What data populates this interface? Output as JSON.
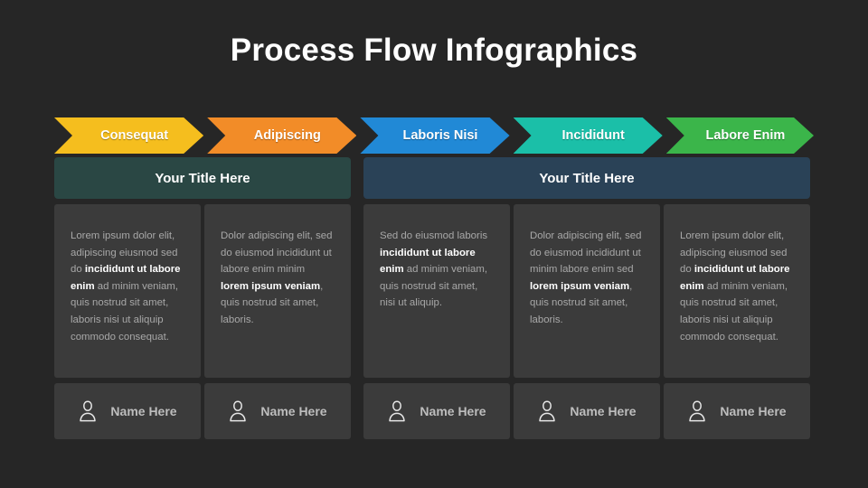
{
  "slide": {
    "title": "Process Flow Infographics",
    "background_color": "#262626",
    "card_color": "#3b3b3b"
  },
  "steps": [
    {
      "label": "Consequat",
      "color": "#F5BE1E"
    },
    {
      "label": "Adipiscing",
      "color": "#F28C28"
    },
    {
      "label": "Laboris Nisi",
      "color": "#2189D6"
    },
    {
      "label": "Incididunt",
      "color": "#1BBFA8"
    },
    {
      "label": "Labore Enim",
      "color": "#3BB council"
    }
  ],
  "headers": [
    {
      "text": "Your Title Here",
      "color": "#2A4744",
      "span": 2
    },
    {
      "text": "Your Title Here",
      "color": "#2A4257",
      "span": 3
    }
  ],
  "columns": [
    {
      "body_parts": [
        {
          "text": "Lorem ipsum dolor elit, adipiscing eiusmod sed do ",
          "bold": false
        },
        {
          "text": "incididunt ut labore enim",
          "bold": true
        },
        {
          "text": " ad minim veniam, quis nostrud sit amet, laboris nisi ut aliquip commodo consequat.",
          "bold": false
        }
      ],
      "name": "Name Here",
      "icon": "person-icon"
    },
    {
      "body_parts": [
        {
          "text": "Dolor adipiscing elit, sed do eiusmod incididunt ut labore enim minim ",
          "bold": false
        },
        {
          "text": "lorem ipsum veniam",
          "bold": true
        },
        {
          "text": ", quis nostrud sit amet, laboris.",
          "bold": false
        }
      ],
      "name": "Name Here",
      "icon": "person-icon"
    },
    {
      "body_parts": [
        {
          "text": "Sed do eiusmod laboris ",
          "bold": false
        },
        {
          "text": "incididunt ut labore enim",
          "bold": true
        },
        {
          "text": " ad minim veniam, quis nostrud sit amet, nisi ut aliquip.",
          "bold": false
        }
      ],
      "name": "Name Here",
      "icon": "person-icon"
    },
    {
      "body_parts": [
        {
          "text": "Dolor adipiscing elit, sed do eiusmod incididunt ut minim labore enim sed ",
          "bold": false
        },
        {
          "text": "lorem ipsum veniam",
          "bold": true
        },
        {
          "text": ", quis nostrud sit amet, laboris.",
          "bold": false
        }
      ],
      "name": "Name Here",
      "icon": "person-icon"
    },
    {
      "body_parts": [
        {
          "text": "Lorem ipsum dolor elit, adipiscing eiusmod sed do ",
          "bold": false
        },
        {
          "text": "incididunt ut labore enim",
          "bold": true
        },
        {
          "text": " ad minim veniam, quis nostrud sit amet, laboris nisi ut aliquip commodo consequat.",
          "bold": false
        }
      ],
      "name": "Name Here",
      "icon": "person-icon"
    }
  ]
}
